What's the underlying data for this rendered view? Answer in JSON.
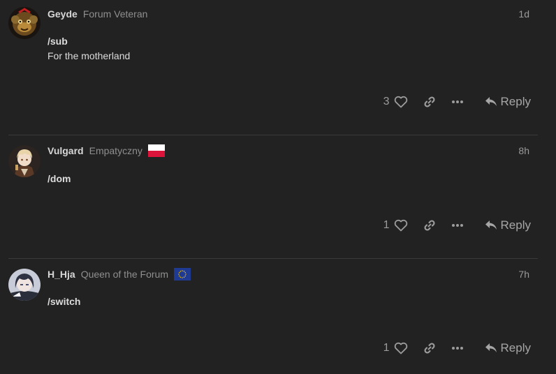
{
  "posts": [
    {
      "username": "Geyde",
      "user_title": "Forum Veteran",
      "flag": "",
      "age": "1d",
      "content": [
        "/sub"
      ],
      "content_text": "For the motherland",
      "likes": "3",
      "reply_label": "Reply",
      "avatar_icon": "monkey-mask-avatar"
    },
    {
      "username": "Vulgard",
      "user_title": "Empatyczny",
      "flag": "poland-flag",
      "age": "8h",
      "content": [
        "/dom"
      ],
      "likes": "1",
      "reply_label": "Reply",
      "avatar_icon": "anime-boy-avatar"
    },
    {
      "username": "H_Hja",
      "user_title": "Queen of the Forum",
      "flag": "eu-flag",
      "age": "7h",
      "content": [
        "/switch"
      ],
      "likes": "1",
      "reply_label": "Reply",
      "avatar_icon": "anime-girl-avatar"
    }
  ],
  "colors": {
    "background": "#222222",
    "username": "#d7d7d7",
    "title": "#8f8f8f",
    "action": "#9c9c9c"
  }
}
